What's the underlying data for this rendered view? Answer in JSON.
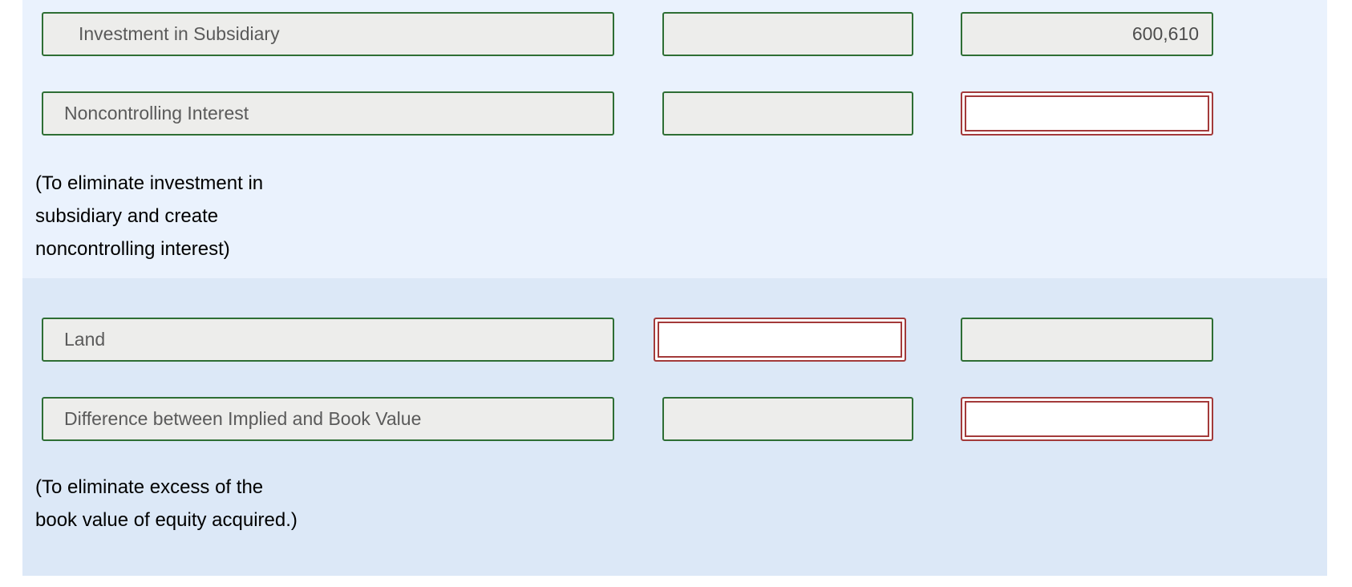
{
  "worksheet": {
    "entries": [
      {
        "shade": "light",
        "rows": [
          {
            "account": "Investment in Subsidiary",
            "account_indent": "wide",
            "debit": "",
            "debit_state": "disabled",
            "credit": "600,610",
            "credit_state": "disabled"
          },
          {
            "account": "Noncontrolling Interest",
            "account_indent": "small",
            "debit": "",
            "debit_state": "disabled",
            "credit": "",
            "credit_state": "answer"
          }
        ],
        "caption": "(To eliminate investment in\nsubsidiary and create\nnoncontrolling interest)"
      },
      {
        "shade": "dark",
        "rows": [
          {
            "account": "Land",
            "account_indent": "small",
            "debit": "",
            "debit_state": "answer",
            "credit": "",
            "credit_state": "disabled"
          },
          {
            "account": "Difference between Implied and Book Value",
            "account_indent": "small",
            "debit": "",
            "debit_state": "disabled",
            "credit": "",
            "credit_state": "answer"
          }
        ],
        "caption": "(To eliminate excess of the\nbook value of equity acquired.)"
      }
    ],
    "colors": {
      "shade_light": "#eaf2fd",
      "shade_dark": "#dce8f7",
      "field_border_disabled": "#2e6e34",
      "field_border_answer": "#a33a3a",
      "field_fill_disabled": "#ededeb",
      "field_fill_answer": "#ffffff",
      "field_text": "#5a5a5a",
      "caption_text": "#000000"
    }
  }
}
